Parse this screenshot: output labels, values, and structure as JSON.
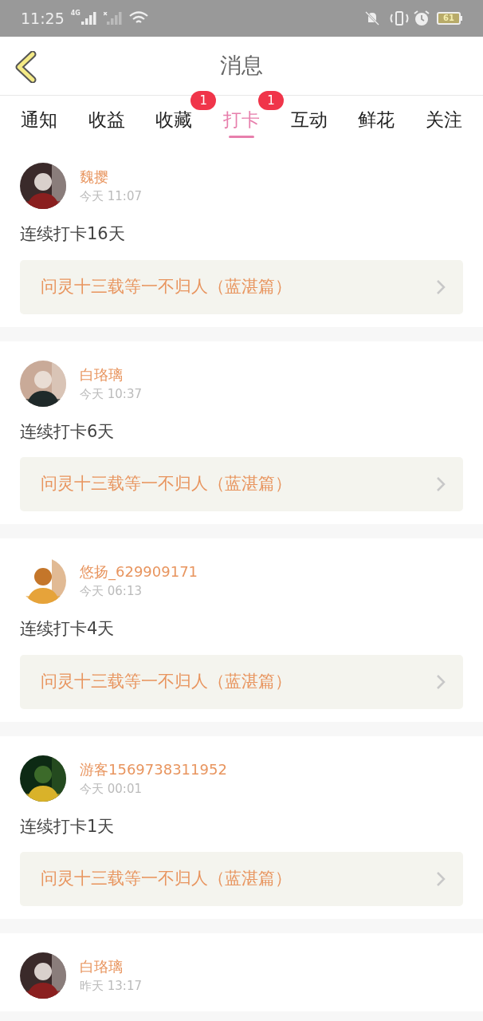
{
  "status_bar": {
    "time": "11:25",
    "network": "4G",
    "battery": "61"
  },
  "header": {
    "title": "消息"
  },
  "tabs": [
    {
      "label": "通知",
      "selected": false
    },
    {
      "label": "收益",
      "selected": false
    },
    {
      "label": "收藏",
      "selected": false,
      "badge": "1"
    },
    {
      "label": "打卡",
      "selected": true,
      "badge": "1"
    },
    {
      "label": "互动",
      "selected": false
    },
    {
      "label": "鲜花",
      "selected": false
    },
    {
      "label": "关注",
      "selected": false
    }
  ],
  "messages": [
    {
      "name": "魏撄",
      "time": "今天 11:07",
      "text": "连续打卡16天",
      "book": "问灵十三载等一不归人（蓝湛篇）"
    },
    {
      "name": "白珞璃",
      "time": "今天 10:37",
      "text": "连续打卡6天",
      "book": "问灵十三载等一不归人（蓝湛篇）"
    },
    {
      "name": "悠扬_629909171",
      "time": "今天 06:13",
      "text": "连续打卡4天",
      "book": "问灵十三载等一不归人（蓝湛篇）"
    },
    {
      "name": "游客1569738311952",
      "time": "今天 00:01",
      "text": "连续打卡1天",
      "book": "问灵十三载等一不归人（蓝湛篇）"
    },
    {
      "name": "白珞璃",
      "time": "昨天 13:17"
    }
  ]
}
